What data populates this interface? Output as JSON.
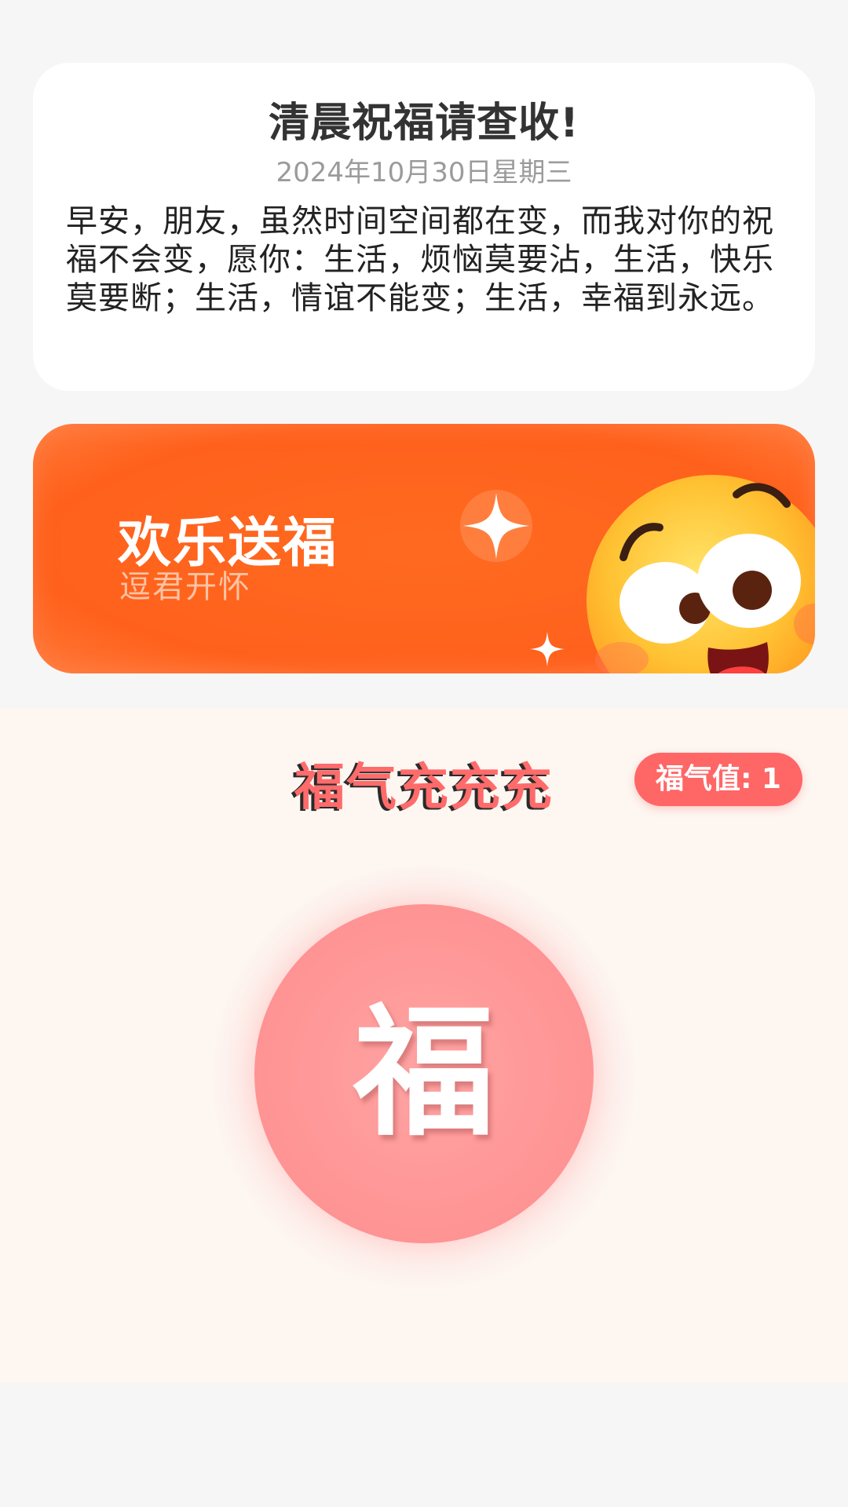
{
  "greeting": {
    "title": "清晨祝福请查收!",
    "date": "2024年10月30日星期三",
    "message": "早安，朋友，虽然时间空间都在变，而我对你的祝福不会变，愿你：生活，烦恼莫要沾，生活，快乐莫要断；生活，情谊不能变；生活，幸福到永远。"
  },
  "banner": {
    "title": "欢乐送福",
    "subtitle": "逗君开怀",
    "color": "#ff611c",
    "icons": [
      "sparkle-icon",
      "smiley-emoji-icon"
    ]
  },
  "blessing": {
    "title": "福气充充充",
    "value_label": "福气值: 1",
    "button_char": "福",
    "accent_color": "#ff6666"
  }
}
